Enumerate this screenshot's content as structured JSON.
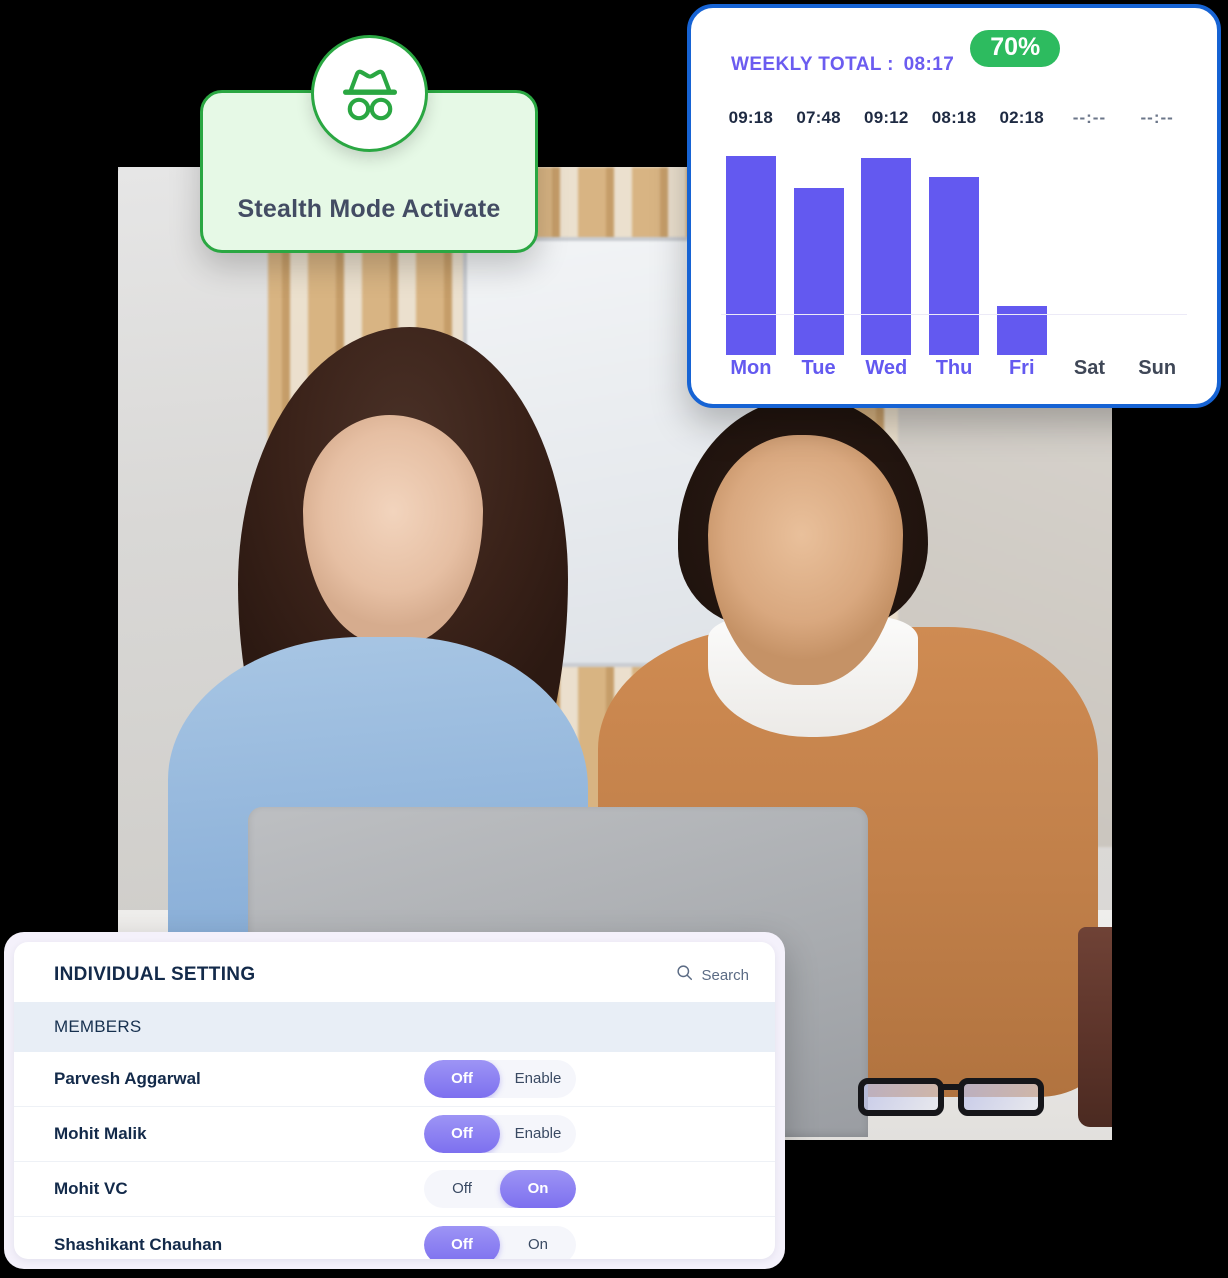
{
  "stealth": {
    "label": "Stealth Mode Activate",
    "icon": "incognito-hat-glasses-icon",
    "border_color": "#2aa742",
    "fill_color": "#e6f9e6"
  },
  "chart_card": {
    "total_prefix": "WEEKLY TOTAL :",
    "total_value": "08:17",
    "percent_badge": "70%",
    "badge_color": "#2dbb5f",
    "accent_color": "#6359f0",
    "border_color": "#1663d4"
  },
  "chart_data": {
    "type": "bar",
    "title": "WEEKLY TOTAL : 08:17",
    "categories": [
      "Mon",
      "Tue",
      "Wed",
      "Thu",
      "Fri",
      "Sat",
      "Sun"
    ],
    "value_labels": [
      "09:18",
      "07:48",
      "09:12",
      "08:18",
      "02:18",
      "--:--",
      "--:--"
    ],
    "values": [
      9.3,
      7.8,
      9.2,
      8.3,
      2.3,
      0,
      0
    ],
    "values_unit": "hours",
    "ylim": [
      0,
      10
    ],
    "xlabel": "",
    "ylabel": "",
    "grid": false,
    "legend": "none",
    "bar_color": "#6359f0",
    "active_day_label_color": "#6359f0",
    "inactive_day_label_color": "#3f4757",
    "inactive_days": [
      "Sat",
      "Sun"
    ]
  },
  "setting_panel": {
    "title": "INDIVIDUAL SETTING",
    "search": {
      "icon": "search-icon",
      "label": "Search"
    },
    "section_header": "MEMBERS",
    "members": [
      {
        "name": "Parvesh Aggarwal",
        "left_option": "Off",
        "right_option": "Enable",
        "active": "left"
      },
      {
        "name": "Mohit Malik",
        "left_option": "Off",
        "right_option": "Enable",
        "active": "left"
      },
      {
        "name": "Mohit VC",
        "left_option": "Off",
        "right_option": "On",
        "active": "right"
      },
      {
        "name": "Shashikant Chauhan",
        "left_option": "Off",
        "right_option": "On",
        "active": "left"
      }
    ]
  }
}
